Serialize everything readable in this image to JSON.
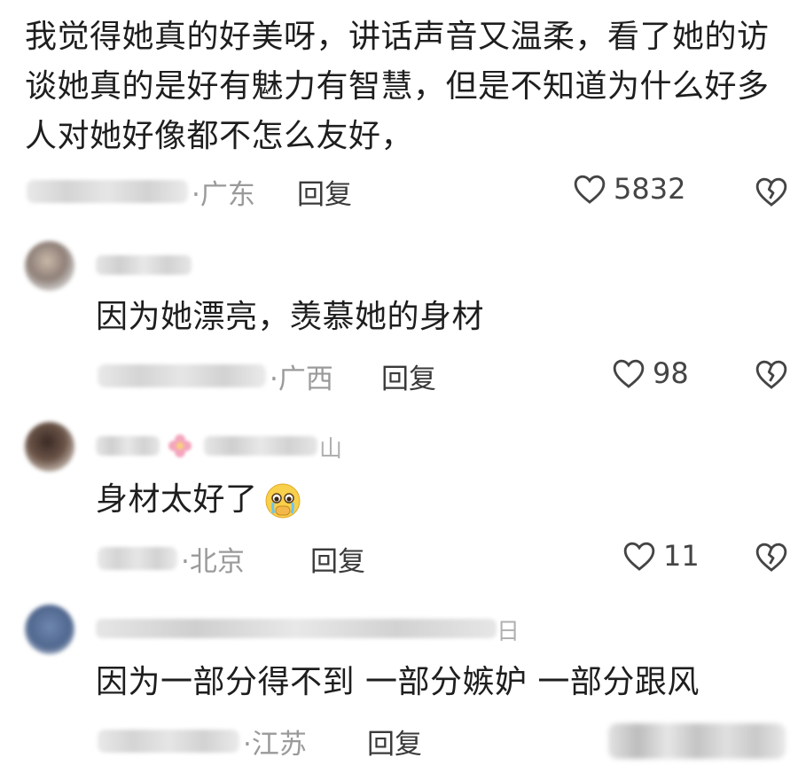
{
  "main_comment": {
    "text": "我觉得她真的好美呀，讲话声音又温柔，看了她的访谈她真的是好有魅力有智慧，但是不知道为什么好多人对她好像都不怎么友好，",
    "location": "·广东",
    "reply_label": "回复",
    "likes": "5832",
    "icons": {
      "like": "heart-outline-icon",
      "dislike": "broken-heart-icon"
    }
  },
  "replies": [
    {
      "text": "因为她漂亮，羡慕她的身材",
      "location": "·广西",
      "reply_label": "回复",
      "likes": "98"
    },
    {
      "name_tail": "山",
      "text": "身材太好了",
      "emoji": "crying-face-emoji",
      "location": "·北京",
      "reply_label": "回复",
      "likes": "11"
    },
    {
      "name_tail": "日",
      "text": "因为一部分得不到 一部分嫉妒 一部分跟风",
      "location": "·江苏",
      "reply_label": "回复"
    }
  ],
  "colors": {
    "primary_text": "#1e1e1e",
    "meta_text": "#9a9a9a",
    "icon": "#444444"
  }
}
